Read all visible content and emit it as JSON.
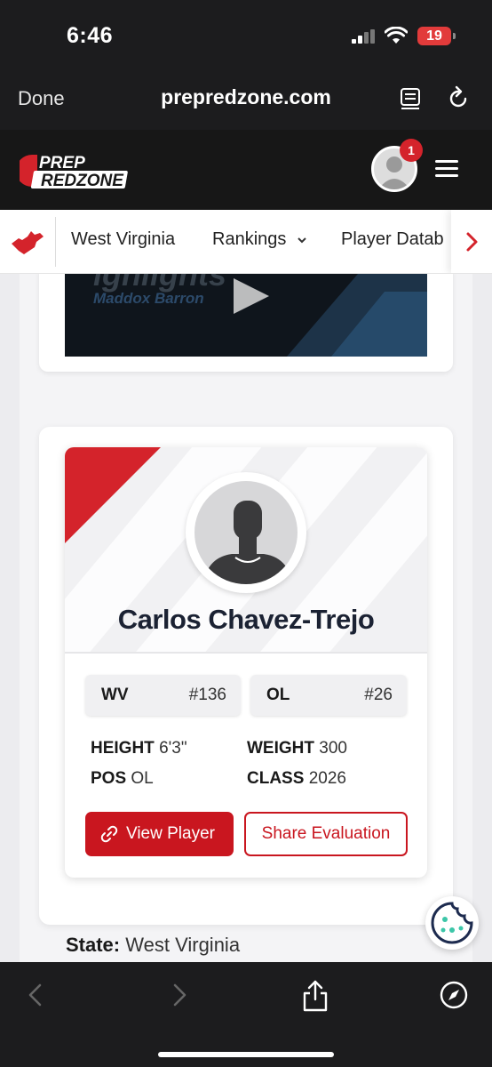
{
  "status_bar": {
    "time": "6:46",
    "battery": "19"
  },
  "browser": {
    "done_label": "Done",
    "url": "prepredzone.com"
  },
  "site": {
    "notification_count": "1"
  },
  "nav": {
    "items": [
      {
        "label": "West Virginia"
      },
      {
        "label": "Rankings",
        "has_dropdown": true
      },
      {
        "label": "Player Datab"
      }
    ]
  },
  "video": {
    "title_fragment": "ighlights",
    "player_name": "Maddox Barron"
  },
  "player": {
    "name": "Carlos Chavez-Trejo",
    "state_rank": {
      "label": "WV",
      "value": "#136"
    },
    "position_rank": {
      "label": "OL",
      "value": "#26"
    },
    "stats": {
      "height_label": "HEIGHT",
      "height": "6'3\"",
      "weight_label": "WEIGHT",
      "weight": "300",
      "pos_label": "POS",
      "pos": "OL",
      "class_label": "CLASS",
      "class": "2026"
    },
    "view_button": "View Player",
    "share_button": "Share Evaluation"
  },
  "details": {
    "state_label": "State:",
    "state_value": "West Virginia"
  },
  "colors": {
    "brand_red": "#d4232b",
    "button_red": "#c9161f",
    "header_dark": "#171717"
  },
  "icons": [
    "signal-icon",
    "wifi-icon",
    "reader-icon",
    "reload-icon",
    "state-map-icon",
    "chevron-down-icon",
    "chevron-right-icon",
    "link-icon",
    "cookie-icon",
    "back-icon",
    "forward-icon",
    "share-icon",
    "compass-icon"
  ]
}
